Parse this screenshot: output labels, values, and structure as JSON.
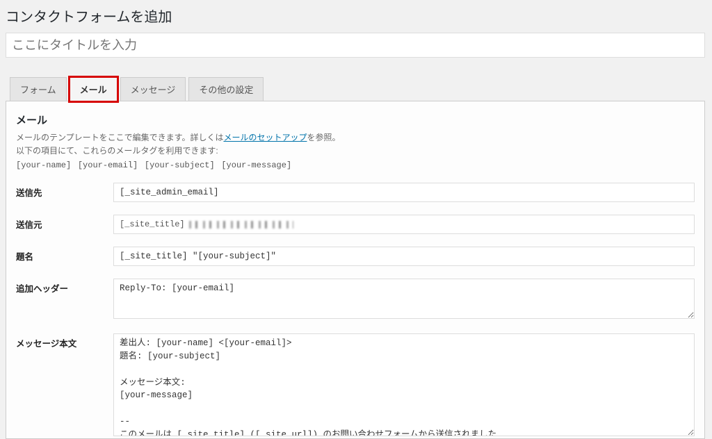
{
  "page": {
    "title": "コンタクトフォームを追加",
    "title_placeholder": "ここにタイトルを入力"
  },
  "tabs": {
    "form": "フォーム",
    "mail": "メール",
    "messages": "メッセージ",
    "other": "その他の設定"
  },
  "panel": {
    "heading": "メール",
    "desc_prefix": "メールのテンプレートをここで編集できます。詳しくは",
    "desc_link": "メールのセットアップ",
    "desc_suffix": "を参照。",
    "desc_line2": "以下の項目にて、これらのメールタグを利用できます:",
    "mailtags": [
      "[your-name]",
      "[your-email]",
      "[your-subject]",
      "[your-message]"
    ]
  },
  "labels": {
    "to": "送信先",
    "from": "送信元",
    "subject": "題名",
    "headers": "追加ヘッダー",
    "body": "メッセージ本文"
  },
  "values": {
    "to": "[_site_admin_email]",
    "from_prefix": "[_site_title]",
    "subject": "[_site_title] \"[your-subject]\"",
    "headers": "Reply-To: [your-email]",
    "body": "差出人: [your-name] <[your-email]>\n題名: [your-subject]\n\nメッセージ本文:\n[your-message]\n\n--\nこのメールは [_site_title] ([_site_url]) のお問い合わせフォームから送信されました"
  }
}
